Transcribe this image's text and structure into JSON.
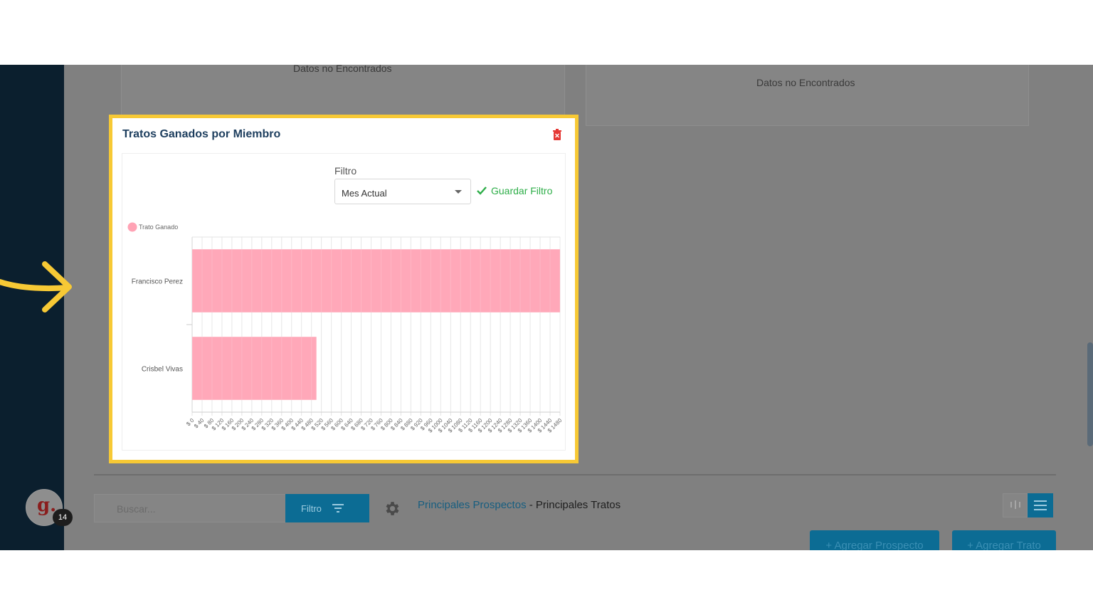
{
  "background_cards": {
    "left_no_data": "Datos no Encontrados",
    "right_no_data": "Datos no Encontrados"
  },
  "widget": {
    "title": "Tratos Ganados por Miembro",
    "filter_label": "Filtro",
    "filter_value": "Mes Actual",
    "save_filter_label": "Guardar Filtro",
    "accent_color": "#f7c935"
  },
  "chart_data": {
    "type": "bar",
    "orientation": "horizontal",
    "categories": [
      "Francisco Perez",
      "Crisbel Vivas"
    ],
    "series": [
      {
        "name": "Trato Ganado",
        "values": [
          1480,
          500
        ],
        "color": "#ffa3b5"
      }
    ],
    "xticks": [
      "$ 0",
      "$ 40",
      "$ 80",
      "$ 120",
      "$ 160",
      "$ 200",
      "$ 240",
      "$ 280",
      "$ 320",
      "$ 360",
      "$ 400",
      "$ 440",
      "$ 480",
      "$ 520",
      "$ 560",
      "$ 600",
      "$ 640",
      "$ 680",
      "$ 720",
      "$ 760",
      "$ 800",
      "$ 840",
      "$ 880",
      "$ 920",
      "$ 960",
      "$ 1000",
      "$ 1040",
      "$ 1080",
      "$ 1120",
      "$ 1160",
      "$ 1200",
      "$ 1240",
      "$ 1280",
      "$ 1320",
      "$ 1360",
      "$ 1400",
      "$ 1440",
      "$ 1480"
    ],
    "xlim": [
      0,
      1480
    ],
    "legend_position": "top-left",
    "grid": true
  },
  "bottom_bar": {
    "search_placeholder": "Buscar...",
    "filter_button": "Filtro",
    "link_prospects": "Principales Prospectos",
    "separator": " - ",
    "link_deals": "Principales Tratos",
    "add_prospect": "+ Agregar Prospecto",
    "add_deal": "+ Agregar Trato"
  },
  "user": {
    "avatar_letter": "g.",
    "badge_count": "14"
  }
}
